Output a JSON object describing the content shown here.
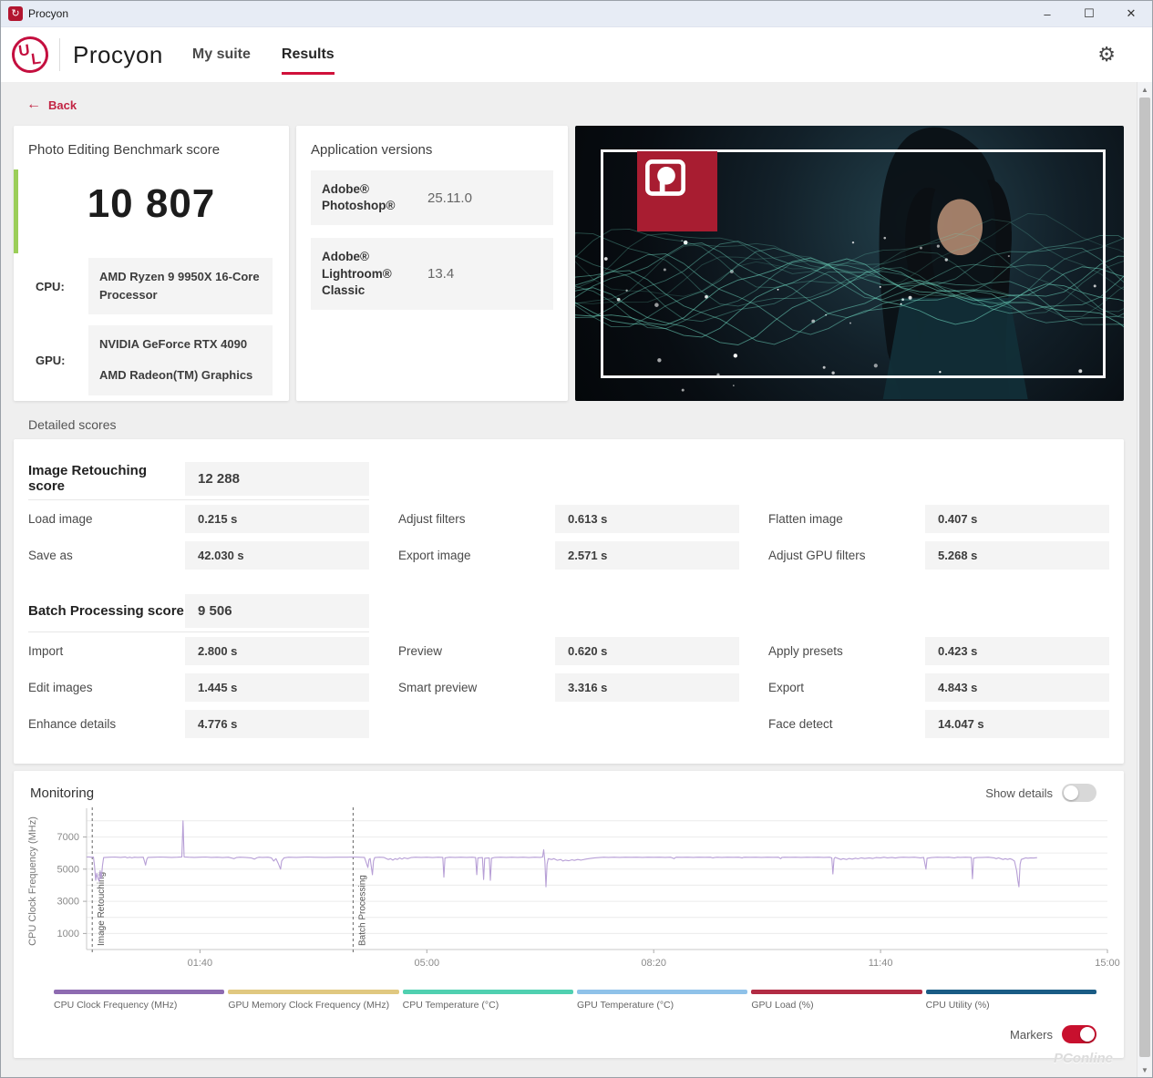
{
  "titlebar": {
    "title": "Procyon"
  },
  "icons": {
    "app_glyph": "↻",
    "minimize": "–",
    "maximize": "☐",
    "close": "✕",
    "back_arrow": "←",
    "gear": "⚙",
    "scroll_up": "▲",
    "scroll_down": "▼"
  },
  "header": {
    "brand": "Procyon",
    "nav": [
      {
        "label": "My suite",
        "active": false
      },
      {
        "label": "Results",
        "active": true
      }
    ]
  },
  "back_label": "Back",
  "score_card": {
    "title": "Photo Editing Benchmark score",
    "score": "10 807",
    "cpu_label": "CPU:",
    "cpu_value": "AMD Ryzen 9 9950X 16-Core Processor",
    "gpu_label": "GPU:",
    "gpu_value_1": "NVIDIA GeForce RTX 4090",
    "gpu_value_2": "AMD Radeon(TM) Graphics",
    "accent_color": "#9bce58"
  },
  "versions_card": {
    "title": "Application versions",
    "items": [
      {
        "name": "Adobe® Photoshop®",
        "version": "25.11.0"
      },
      {
        "name": "Adobe® Lightroom® Classic",
        "version": "13.4"
      }
    ]
  },
  "detailed": {
    "section_label": "Detailed scores",
    "cells": [
      {
        "label": "Image Retouching score",
        "value": "12 288"
      },
      {
        "label": "Load image",
        "value": "0.215 s"
      },
      {
        "label": "Adjust filters",
        "value": "0.613 s"
      },
      {
        "label": "Flatten image",
        "value": "0.407 s"
      },
      {
        "label": "Save as",
        "value": "42.030 s"
      },
      {
        "label": "Export image",
        "value": "2.571 s"
      },
      {
        "label": "Adjust GPU filters",
        "value": "5.268 s"
      },
      {
        "label": "Batch Processing score",
        "value": "9 506"
      },
      {
        "label": "Import",
        "value": "2.800 s"
      },
      {
        "label": "Preview",
        "value": "0.620 s"
      },
      {
        "label": "Apply presets",
        "value": "0.423 s"
      },
      {
        "label": "Edit images",
        "value": "1.445 s"
      },
      {
        "label": "Smart preview",
        "value": "3.316 s"
      },
      {
        "label": "Export",
        "value": "4.843 s"
      },
      {
        "label": "Enhance details",
        "value": "4.776 s"
      },
      {
        "label": "Face detect",
        "value": "14.047 s"
      }
    ]
  },
  "monitoring": {
    "title": "Monitoring",
    "show_details_label": "Show details",
    "markers_label": "Markers",
    "toggle_on_color": "#c8102e"
  },
  "chart_data": {
    "type": "line",
    "title": "Monitoring",
    "ylabel": "CPU Clock Frequency (MHz)",
    "xlabel": "",
    "ylim": [
      0,
      8500
    ],
    "xlim_seconds": [
      0,
      900
    ],
    "grid": true,
    "y_ticks": [
      1000,
      3000,
      5000,
      7000
    ],
    "x_ticks": [
      {
        "s": 100,
        "label": "01:40"
      },
      {
        "s": 300,
        "label": "05:00"
      },
      {
        "s": 500,
        "label": "08:20"
      },
      {
        "s": 700,
        "label": "11:40"
      },
      {
        "s": 900,
        "label": "15:00"
      }
    ],
    "markers": [
      {
        "s": 5,
        "label": "Image Retouching"
      },
      {
        "s": 235,
        "label": "Batch Processing"
      }
    ],
    "series": [
      {
        "name": "CPU Clock Frequency (MHz)",
        "color": "#b79fd6",
        "points": [
          [
            0,
            5750
          ],
          [
            2,
            5760
          ],
          [
            4,
            5740
          ],
          [
            6,
            5750
          ],
          [
            7,
            5200
          ],
          [
            8,
            4300
          ],
          [
            9,
            4750
          ],
          [
            10,
            4450
          ],
          [
            11,
            4250
          ],
          [
            12,
            4900
          ],
          [
            13,
            4400
          ],
          [
            14,
            5200
          ],
          [
            15,
            5720
          ],
          [
            20,
            5740
          ],
          [
            25,
            5750
          ],
          [
            30,
            5730
          ],
          [
            34,
            5760
          ],
          [
            36,
            5700
          ],
          [
            38,
            5740
          ],
          [
            40,
            5700
          ],
          [
            42,
            5740
          ],
          [
            45,
            5730
          ],
          [
            50,
            5740
          ],
          [
            52,
            5250
          ],
          [
            53,
            5600
          ],
          [
            54,
            5730
          ],
          [
            60,
            5740
          ],
          [
            65,
            5750
          ],
          [
            70,
            5740
          ],
          [
            75,
            5730
          ],
          [
            80,
            5740
          ],
          [
            84,
            5760
          ],
          [
            85,
            8000
          ],
          [
            86,
            5760
          ],
          [
            90,
            5740
          ],
          [
            95,
            5730
          ],
          [
            100,
            5740
          ],
          [
            105,
            5750
          ],
          [
            110,
            5730
          ],
          [
            115,
            5740
          ],
          [
            120,
            5720
          ],
          [
            125,
            5740
          ],
          [
            130,
            5650
          ],
          [
            132,
            5720
          ],
          [
            135,
            5740
          ],
          [
            140,
            5730
          ],
          [
            145,
            5700
          ],
          [
            148,
            5620
          ],
          [
            150,
            5700
          ],
          [
            152,
            5740
          ],
          [
            155,
            5730
          ],
          [
            160,
            5740
          ],
          [
            163,
            5700
          ],
          [
            165,
            5500
          ],
          [
            167,
            5650
          ],
          [
            169,
            5350
          ],
          [
            171,
            5000
          ],
          [
            172,
            5500
          ],
          [
            174,
            5700
          ],
          [
            178,
            5740
          ],
          [
            185,
            5730
          ],
          [
            190,
            5740
          ],
          [
            195,
            5750
          ],
          [
            200,
            5740
          ],
          [
            210,
            5730
          ],
          [
            220,
            5740
          ],
          [
            230,
            5740
          ],
          [
            235,
            5750
          ],
          [
            240,
            5740
          ],
          [
            245,
            5730
          ],
          [
            248,
            5100
          ],
          [
            249,
            5600
          ],
          [
            250,
            5660
          ],
          [
            252,
            4650
          ],
          [
            253,
            5500
          ],
          [
            254,
            5720
          ],
          [
            258,
            5740
          ],
          [
            262,
            5730
          ],
          [
            266,
            5600
          ],
          [
            268,
            5650
          ],
          [
            270,
            5560
          ],
          [
            272,
            5650
          ],
          [
            274,
            5600
          ],
          [
            276,
            5700
          ],
          [
            278,
            5620
          ],
          [
            280,
            5700
          ],
          [
            283,
            5650
          ],
          [
            286,
            5720
          ],
          [
            290,
            5740
          ],
          [
            295,
            5730
          ],
          [
            300,
            5740
          ],
          [
            305,
            5720
          ],
          [
            310,
            5740
          ],
          [
            314,
            5730
          ],
          [
            315,
            4500
          ],
          [
            316,
            5700
          ],
          [
            320,
            5740
          ],
          [
            325,
            5730
          ],
          [
            330,
            5740
          ],
          [
            335,
            5730
          ],
          [
            340,
            5740
          ],
          [
            343,
            5720
          ],
          [
            344,
            4650
          ],
          [
            345,
            5700
          ],
          [
            349,
            5720
          ],
          [
            350,
            4350
          ],
          [
            351,
            5680
          ],
          [
            355,
            5700
          ],
          [
            356,
            4300
          ],
          [
            357,
            5680
          ],
          [
            360,
            5730
          ],
          [
            365,
            5740
          ],
          [
            370,
            5730
          ],
          [
            375,
            5740
          ],
          [
            380,
            5730
          ],
          [
            385,
            5740
          ],
          [
            390,
            5720
          ],
          [
            395,
            5740
          ],
          [
            400,
            5730
          ],
          [
            402,
            5750
          ],
          [
            403,
            6200
          ],
          [
            404,
            5500
          ],
          [
            405,
            3900
          ],
          [
            406,
            5300
          ],
          [
            407,
            5650
          ],
          [
            410,
            5600
          ],
          [
            412,
            5650
          ],
          [
            415,
            5550
          ],
          [
            418,
            5600
          ],
          [
            420,
            5500
          ],
          [
            422,
            5560
          ],
          [
            425,
            5520
          ],
          [
            428,
            5580
          ],
          [
            430,
            5540
          ],
          [
            433,
            5600
          ],
          [
            436,
            5560
          ],
          [
            440,
            5620
          ],
          [
            444,
            5660
          ],
          [
            448,
            5700
          ],
          [
            452,
            5720
          ],
          [
            456,
            5740
          ],
          [
            460,
            5730
          ],
          [
            465,
            5740
          ],
          [
            470,
            5730
          ],
          [
            475,
            5740
          ],
          [
            480,
            5735
          ],
          [
            485,
            5740
          ],
          [
            490,
            5730
          ],
          [
            495,
            5740
          ],
          [
            500,
            5735
          ],
          [
            505,
            5740
          ],
          [
            510,
            5730
          ],
          [
            515,
            5740
          ],
          [
            518,
            5650
          ],
          [
            519,
            5720
          ],
          [
            520,
            5740
          ],
          [
            525,
            5735
          ],
          [
            530,
            5740
          ],
          [
            535,
            5730
          ],
          [
            540,
            5740
          ],
          [
            545,
            5735
          ],
          [
            550,
            5740
          ],
          [
            552,
            5700
          ],
          [
            554,
            5730
          ],
          [
            556,
            5740
          ],
          [
            560,
            5730
          ],
          [
            565,
            5740
          ],
          [
            570,
            5735
          ],
          [
            575,
            5740
          ],
          [
            578,
            5700
          ],
          [
            579,
            5730
          ],
          [
            580,
            5740
          ],
          [
            585,
            5735
          ],
          [
            590,
            5740
          ],
          [
            595,
            5730
          ],
          [
            600,
            5740
          ],
          [
            605,
            5735
          ],
          [
            610,
            5740
          ],
          [
            612,
            5650
          ],
          [
            613,
            5730
          ],
          [
            615,
            5740
          ],
          [
            620,
            5735
          ],
          [
            625,
            5740
          ],
          [
            630,
            5730
          ],
          [
            635,
            5740
          ],
          [
            640,
            5735
          ],
          [
            645,
            5740
          ],
          [
            650,
            5730
          ],
          [
            655,
            5740
          ],
          [
            657,
            5700
          ],
          [
            658,
            4700
          ],
          [
            659,
            5650
          ],
          [
            660,
            5730
          ],
          [
            663,
            5650
          ],
          [
            665,
            5600
          ],
          [
            667,
            5650
          ],
          [
            670,
            5600
          ],
          [
            672,
            5660
          ],
          [
            675,
            5620
          ],
          [
            678,
            5680
          ],
          [
            680,
            5640
          ],
          [
            683,
            5700
          ],
          [
            686,
            5660
          ],
          [
            690,
            5700
          ],
          [
            693,
            5660
          ],
          [
            696,
            5720
          ],
          [
            700,
            5700
          ],
          [
            703,
            5740
          ],
          [
            706,
            5700
          ],
          [
            710,
            5730
          ],
          [
            713,
            5690
          ],
          [
            716,
            5730
          ],
          [
            720,
            5740
          ],
          [
            725,
            5730
          ],
          [
            730,
            5740
          ],
          [
            735,
            5700
          ],
          [
            738,
            5730
          ],
          [
            740,
            5000
          ],
          [
            741,
            5680
          ],
          [
            745,
            5720
          ],
          [
            750,
            5740
          ],
          [
            755,
            5730
          ],
          [
            760,
            5740
          ],
          [
            765,
            5700
          ],
          [
            768,
            5740
          ],
          [
            770,
            5730
          ],
          [
            775,
            5740
          ],
          [
            780,
            5730
          ],
          [
            781,
            4400
          ],
          [
            782,
            5680
          ],
          [
            785,
            5720
          ],
          [
            790,
            5730
          ],
          [
            795,
            5740
          ],
          [
            800,
            5700
          ],
          [
            802,
            5650
          ],
          [
            804,
            5700
          ],
          [
            806,
            5650
          ],
          [
            808,
            5600
          ],
          [
            810,
            5650
          ],
          [
            812,
            5600
          ],
          [
            814,
            5650
          ],
          [
            816,
            5600
          ],
          [
            818,
            5500
          ],
          [
            820,
            4900
          ],
          [
            821,
            4300
          ],
          [
            822,
            3900
          ],
          [
            823,
            5300
          ],
          [
            824,
            5600
          ],
          [
            826,
            5650
          ],
          [
            828,
            5700
          ],
          [
            830,
            5680
          ],
          [
            832,
            5700
          ],
          [
            835,
            5690
          ],
          [
            838,
            5710
          ]
        ]
      }
    ],
    "legend": [
      {
        "label": "CPU Clock Frequency (MHz)",
        "color": "#8e6bb1"
      },
      {
        "label": "GPU Memory Clock Frequency (MHz)",
        "color": "#e0c880"
      },
      {
        "label": "CPU Temperature (°C)",
        "color": "#50d0b0"
      },
      {
        "label": "GPU Temperature (°C)",
        "color": "#8fc2e9"
      },
      {
        "label": "GPU Load (%)",
        "color": "#b22c44"
      },
      {
        "label": "CPU Utility (%)",
        "color": "#1a5c85"
      }
    ],
    "legend_position": "bottom"
  },
  "watermark": {
    "text": "PConline"
  }
}
